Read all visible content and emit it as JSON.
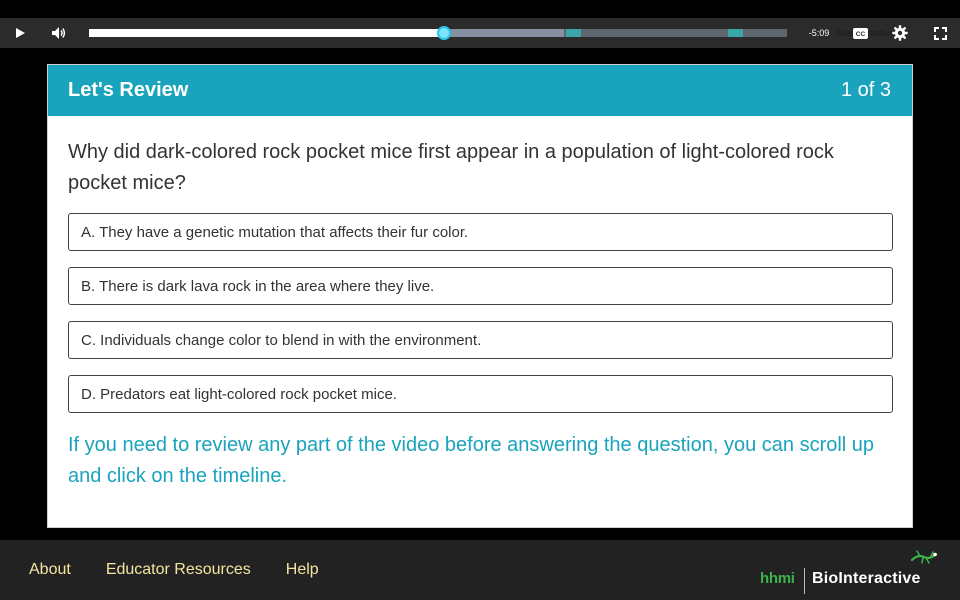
{
  "player": {
    "time_remaining": "-5:09",
    "progress_fraction": 0.508,
    "buffer_end_fraction": 0.68,
    "chapter_markers": [
      {
        "start": 0.683,
        "end": 0.705
      },
      {
        "start": 0.915,
        "end": 0.937
      }
    ],
    "watermark_text": "BioInteractive",
    "icons": {
      "play": "play-icon",
      "volume": "volume-icon",
      "cc": "closed-captions-icon",
      "settings": "gear-icon",
      "fullscreen": "fullscreen-icon"
    },
    "colors": {
      "handle": "#7fe3ff",
      "marker": "#3aa6a6"
    }
  },
  "review": {
    "title": "Let's Review",
    "counter": "1 of 3",
    "question": "Why did dark-colored rock pocket mice first appear in a population of light-colored rock pocket mice?",
    "answers": [
      "A. They have a genetic mutation that affects their fur color.",
      "B. There is dark lava rock in the area where they live.",
      "C. Individuals change color to blend in with the environment.",
      "D. Predators eat light-colored rock pocket mice."
    ],
    "hint": "If you need to review any part of the video before answering the question, you can scroll up and click on the timeline.",
    "accent_color": "#1aa3bd"
  },
  "footer": {
    "links": [
      "About",
      "Educator Resources",
      "Help"
    ],
    "brand_hhmi": "hhmi",
    "brand_name": "BioInteractive",
    "link_color": "#f2e6a0"
  }
}
